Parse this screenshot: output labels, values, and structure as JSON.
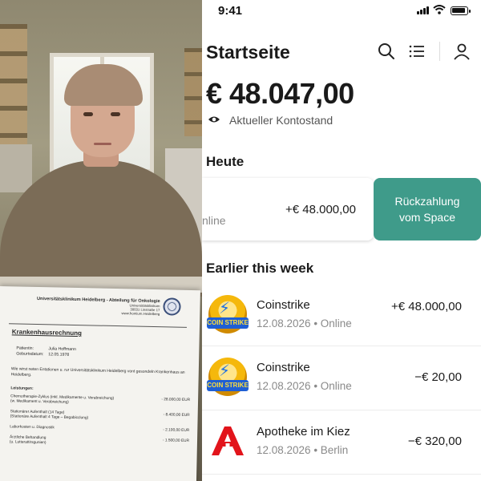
{
  "status_bar": {
    "time": "9:41"
  },
  "header": {
    "title": "Startseite",
    "icons": [
      "search-icon",
      "list-icon",
      "profile-icon"
    ]
  },
  "balance": {
    "amount": "€ 48.047,00",
    "label": "Aktueller Kontostand",
    "icon": "eye-icon"
  },
  "today": {
    "heading": "Heute",
    "transaction": {
      "partial_text": "nline",
      "amount": "+€ 48.000,00"
    },
    "action_label": "Rückzahlung vom Space",
    "action_color": "#3f9b8a"
  },
  "earlier": {
    "heading": "Earlier this week",
    "transactions": [
      {
        "name": "Coinstrike",
        "meta": "12.08.2026 • Online",
        "amount": "+€ 48.000,00",
        "logo": "coinstrike-logo"
      },
      {
        "name": "Coinstrike",
        "meta": "12.08.2026 • Online",
        "amount": "−€ 20,00",
        "logo": "coinstrike-logo"
      },
      {
        "name": "Apotheke im Kiez",
        "meta": "12.08.2026 • Berlin",
        "amount": "−€ 320,00",
        "logo": "pharmacy-logo"
      }
    ]
  },
  "coin_logo_text": "COIN STRIKE",
  "document": {
    "clinic": "Universitätsklinikum Heidelberg - Abteilung für Onkologie",
    "address": [
      "Universitätsklinikum",
      "30031 Linstraße 17",
      "www.frontium.Heidelberg"
    ],
    "title": "Krankenhausrechnung",
    "patient_label": "Patientin:",
    "patient": "Julia Hoffmann",
    "dob_label": "Geburtsdatum:",
    "dob": "12.05.1978",
    "intro": "Wie wirst neten Entationen u. rur Universitätsklinikum Heidelberg vont gesondeln Krankenhaus an Heidelberg.",
    "services_label": "Leistungen:",
    "items": [
      {
        "label": "Chemotherapie-Zyklus (inkl. Medikamente u. Verabreichung)",
        "sub": "(w. Medikament u. Verabreichung)",
        "amount": "- 28.000,00 EUR"
      },
      {
        "label": "Stationärer Aufenthalt (14 Tage)",
        "sub": "(Stationäre Aufenthalt 4 Tage – Begabicclung)",
        "amount": "- 8.400,00 EUR"
      },
      {
        "label": "Laborkosten u. Diagnostik",
        "sub": "",
        "amount": "- 2.100,00 EUR"
      },
      {
        "label": "Ärztliche Behandlung",
        "sub": "(u. Lutterattirsgunien)",
        "amount": "- 1.500,00 EUR"
      }
    ]
  }
}
